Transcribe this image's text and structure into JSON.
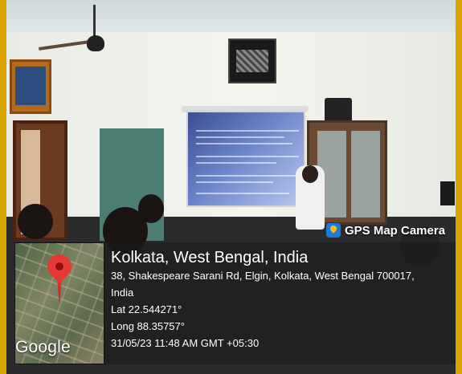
{
  "overlay": {
    "badge_label": "GPS Map Camera",
    "badge_icon": "gps-map-camera-icon",
    "location_title": "Kolkata, West Bengal, India",
    "address_line1": "38, Shakespeare Sarani Rd, Elgin, Kolkata, West Bengal 700017,",
    "address_line2": "India",
    "latitude": "Lat 22.544271°",
    "longitude": "Long 88.35757°",
    "timestamp": "31/05/23 11:48 AM GMT +05:30",
    "map_logo": "Google",
    "pin_icon": "location-pin-icon"
  },
  "colors": {
    "frame": "#d9a300",
    "pin": "#e53935",
    "panel_bg": "rgba(25,25,25,0.58)"
  }
}
